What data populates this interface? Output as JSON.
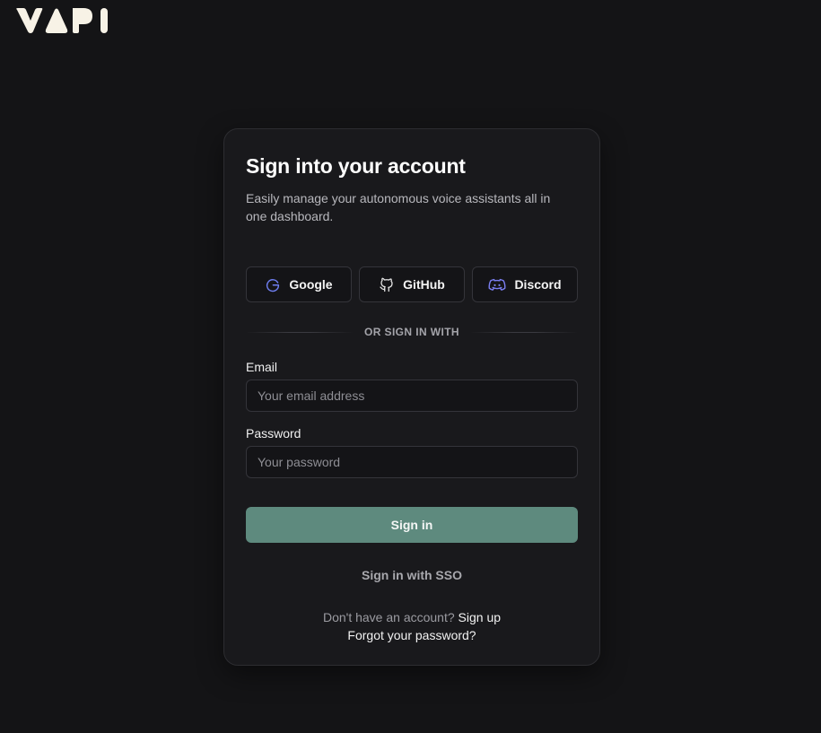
{
  "brand": {
    "name": "VAPI",
    "logo_color": "#f7f2e6"
  },
  "card": {
    "title": "Sign into your account",
    "subtitle": "Easily manage your autonomous voice assistants all in one dashboard."
  },
  "oauth": [
    {
      "label": "Google",
      "icon": "google-icon",
      "icon_color": "#6e7ef0"
    },
    {
      "label": "GitHub",
      "icon": "github-icon",
      "icon_color": "#e8e8e8"
    },
    {
      "label": "Discord",
      "icon": "discord-icon",
      "icon_color": "#7b7ff2"
    }
  ],
  "divider": {
    "text": "OR SIGN IN WITH"
  },
  "form": {
    "email_label": "Email",
    "email_placeholder": "Your email address",
    "email_value": "",
    "password_label": "Password",
    "password_placeholder": "Your password",
    "password_value": "",
    "submit_label": "Sign in",
    "submit_color": "#5e8a7e"
  },
  "sso": {
    "label": "Sign in with SSO"
  },
  "footer": {
    "no_account_text": "Don't have an account?",
    "signup_label": "Sign up",
    "forgot_label": "Forgot your password?"
  }
}
